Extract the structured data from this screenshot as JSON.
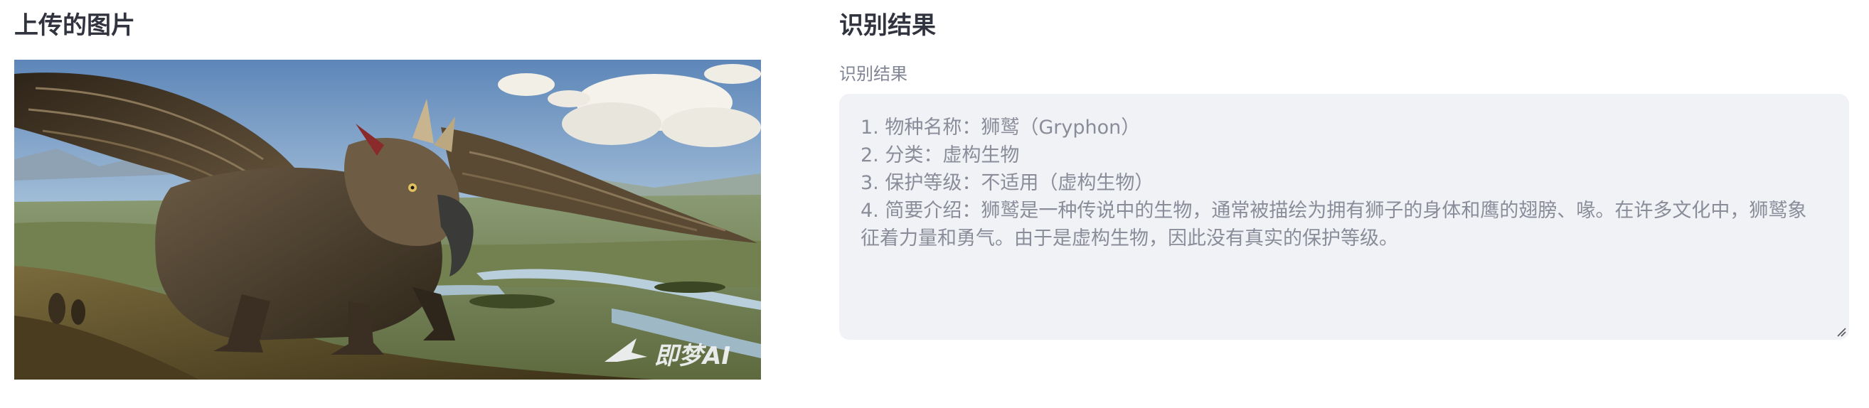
{
  "uploaded_section": {
    "title": "上传的图片",
    "image_alt": "狮鹫站在山坡上俯瞰河谷",
    "watermark": "即梦AI"
  },
  "result_section": {
    "title": "识别结果",
    "field_label": "识别结果",
    "lines": [
      "1. 物种名称：狮鹫（Gryphon）",
      "2. 分类：虚构生物",
      "3. 保护等级：不适用（虚构生物）",
      "4. 简要介绍：狮鹫是一种传说中的生物，通常被描绘为拥有狮子的身体和鹰的翅膀、喙。在许多文化中，狮鹫象",
      "征着力量和勇气。由于是虚构生物，因此没有真实的保护等级。"
    ]
  },
  "colors": {
    "heading": "#31333f",
    "label": "#808495",
    "textarea_bg": "#f0f2f6",
    "textarea_text": "#8a8d99"
  }
}
